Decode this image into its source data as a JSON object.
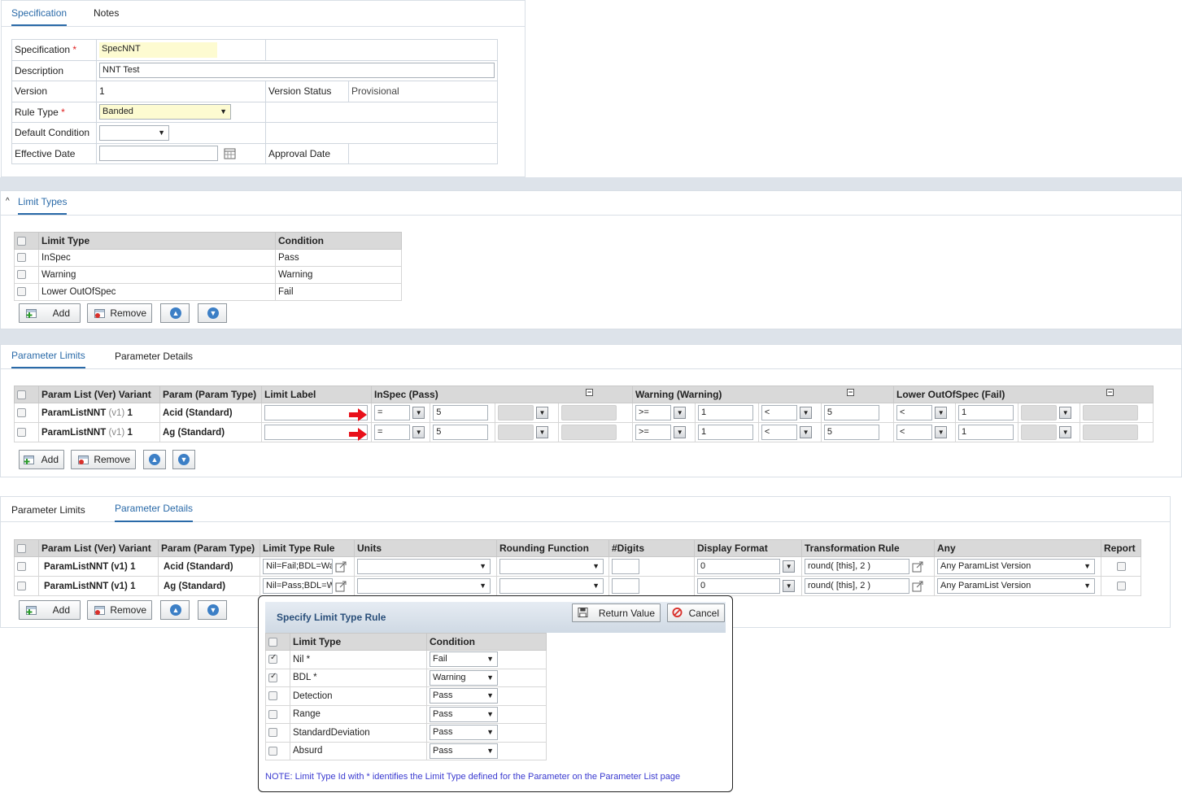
{
  "spec_panel": {
    "tabs": [
      "Specification",
      "Notes"
    ],
    "specification_label": "Specification",
    "specification_value": "SpecNNT",
    "description_label": "Description",
    "description_value": "NNT Test",
    "version_label": "Version",
    "version_value": "1",
    "version_status_label": "Version Status",
    "version_status_value": "Provisional",
    "rule_type_label": "Rule Type",
    "rule_type_value": "Banded",
    "default_condition_label": "Default Condition",
    "default_condition_value": "",
    "effective_date_label": "Effective Date",
    "effective_date_value": "",
    "approval_date_label": "Approval Date",
    "approval_date_value": ""
  },
  "limit_types": {
    "section_title": "Limit Types",
    "headers": [
      "Limit Type",
      "Condition"
    ],
    "rows": [
      {
        "type": "InSpec",
        "condition": "Pass"
      },
      {
        "type": "Warning",
        "condition": "Warning"
      },
      {
        "type": "Lower OutOfSpec",
        "condition": "Fail"
      }
    ],
    "add_label": "Add",
    "remove_label": "Remove"
  },
  "param_limits": {
    "tabs": [
      "Parameter Limits",
      "Parameter Details"
    ],
    "headers": [
      "Param List (Ver) Variant",
      "Param (Param Type)",
      "Limit Label",
      "InSpec (Pass)",
      "Warning (Warning)",
      "Lower OutOfSpec (Fail)"
    ],
    "rows": [
      {
        "list": "ParamListNNT",
        "ver": "(v1)",
        "variant": "1",
        "param": "Acid (Standard)",
        "label": "",
        "in_op": "=",
        "in_val": "5",
        "w_op1": ">=",
        "w_val1": "1",
        "w_op2": "<",
        "w_val2": "5",
        "l_op": "<",
        "l_val": "1"
      },
      {
        "list": "ParamListNNT",
        "ver": "(v1)",
        "variant": "1",
        "param": "Ag (Standard)",
        "label": "",
        "in_op": "=",
        "in_val": "5",
        "w_op1": ">=",
        "w_val1": "1",
        "w_op2": "<",
        "w_val2": "5",
        "l_op": "<",
        "l_val": "1"
      }
    ],
    "add_label": "Add",
    "remove_label": "Remove"
  },
  "param_details": {
    "tabs": [
      "Parameter Limits",
      "Parameter Details"
    ],
    "headers": [
      "Param List (Ver) Variant",
      "Param (Param Type)",
      "Limit Type Rule",
      "Units",
      "Rounding Function",
      "#Digits",
      "Display Format",
      "Transformation Rule",
      "Any",
      "Report"
    ],
    "rows": [
      {
        "list": "ParamListNNT (v1) 1",
        "param": "Acid (Standard)",
        "rule": "Nil=Fail;BDL=Wa",
        "units": "",
        "rounding": "",
        "digits": "",
        "format": "0",
        "transform": "round( [this], 2 )",
        "any": "Any ParamList Version"
      },
      {
        "list": "ParamListNNT (v1) 1",
        "param": "Ag (Standard)",
        "rule": "Nil=Pass;BDL=W",
        "units": "",
        "rounding": "",
        "digits": "",
        "format": "0",
        "transform": "round( [this], 2 )",
        "any": "Any ParamList Version"
      }
    ],
    "add_label": "Add",
    "remove_label": "Remove"
  },
  "dialog": {
    "title": "Specify Limit Type Rule",
    "return_label": "Return Value",
    "cancel_label": "Cancel",
    "headers": [
      "Limit Type",
      "Condition"
    ],
    "rows": [
      {
        "type": "Nil *",
        "condition": "Fail",
        "checked": true
      },
      {
        "type": "BDL *",
        "condition": "Warning",
        "checked": true
      },
      {
        "type": "Detection",
        "condition": "Pass",
        "checked": false
      },
      {
        "type": "Range",
        "condition": "Pass",
        "checked": false
      },
      {
        "type": "StandardDeviation",
        "condition": "Pass",
        "checked": false
      },
      {
        "type": "Absurd",
        "condition": "Pass",
        "checked": false
      }
    ],
    "note": "NOTE: Limit Type Id with * identifies the Limit Type defined for the Parameter on the Parameter List page"
  },
  "colors": {
    "accent": "#2a6aa8",
    "arrow": "#e8101a",
    "panel_bg": "#dde3ea"
  }
}
